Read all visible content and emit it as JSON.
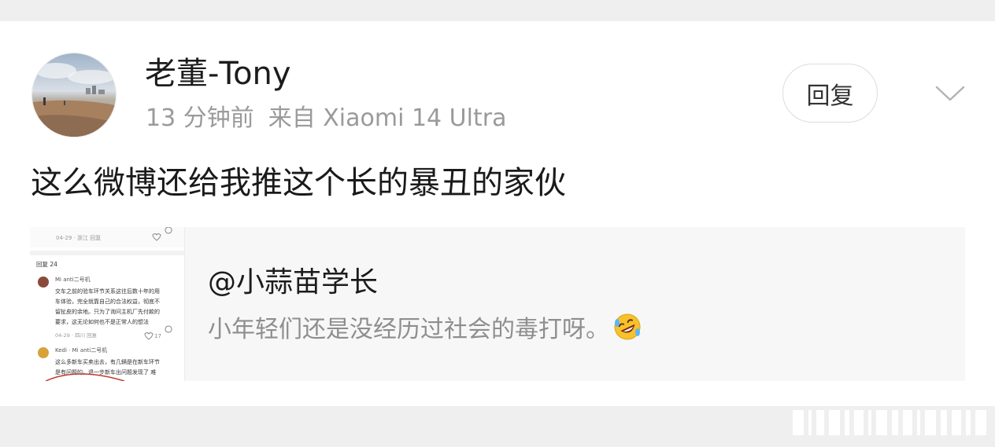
{
  "post": {
    "user_name": "老董-Tony",
    "time": "13 分钟前",
    "source": "来自 Xiaomi 14 Ultra",
    "reply_label": "回复",
    "text": "这么微博还给我推这个长的暴丑的家伙"
  },
  "quote": {
    "author": "@小蒜苗学长",
    "text": "小年轻们还是没经历过社会的毒打呀。",
    "emoji": "rofl-emoji"
  },
  "thumbnail": {
    "top_meta": "04-29 · 浙江  回复",
    "replies_header": "回复 24",
    "comment1_name": "Mi anti二号机",
    "comment1_line1": "交车之前的验车环节关系这往后数十年的用",
    "comment1_line2": "车体验，完全就靠自己的合法权益，彻底不",
    "comment1_line3": "留扯皮的余地。只为了询问主机厂先付款的",
    "comment1_line4": "要求，这无论如何也不是正常人的想法",
    "comment1_meta": "04-29 · 四川  回复",
    "comment1_likes": "17",
    "comment2_name": "Kedi · Mi anti二号机",
    "comment2_line1": "这么多新车买卖出去，有几辆是在新车环节",
    "comment2_line2": "是有问题的。退一步新车出问题发现了 难"
  },
  "icons": {
    "more": "chevron-down-icon",
    "like": "heart-icon",
    "comment": "comment-icon"
  }
}
